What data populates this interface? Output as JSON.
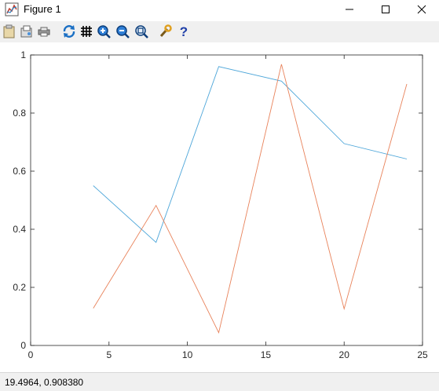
{
  "window": {
    "title": "Figure 1"
  },
  "toolbar": {
    "buttons": [
      {
        "name": "copy-icon"
      },
      {
        "name": "export-icon"
      },
      {
        "name": "print-icon"
      },
      {
        "name": "rotate-icon"
      },
      {
        "name": "grid-icon"
      },
      {
        "name": "zoom-in-icon"
      },
      {
        "name": "zoom-out-icon"
      },
      {
        "name": "autoscale-icon"
      },
      {
        "name": "settings-icon"
      },
      {
        "name": "help-icon"
      }
    ]
  },
  "status": {
    "coordinates": "19.4964,  0.908380"
  },
  "colors": {
    "series1": "#4da6d9",
    "series2": "#e8825a"
  },
  "chart_data": {
    "type": "line",
    "xlim": [
      0,
      25
    ],
    "ylim": [
      0,
      1
    ],
    "xticks": [
      0,
      5,
      10,
      15,
      20,
      25
    ],
    "yticks": [
      0,
      0.2,
      0.4,
      0.6,
      0.8,
      1
    ],
    "xtick_labels": [
      "0",
      "5",
      "10",
      "15",
      "20",
      "25"
    ],
    "ytick_labels": [
      "0",
      "0.2",
      "0.4",
      "0.6",
      "0.8",
      "1"
    ],
    "series": [
      {
        "x": [
          4,
          8,
          12,
          16,
          20,
          24
        ],
        "y": [
          0.55,
          0.355,
          0.96,
          0.91,
          0.695,
          0.642
        ],
        "color": "#4da6d9"
      },
      {
        "x": [
          4,
          8,
          12,
          16,
          20,
          24
        ],
        "y": [
          0.128,
          0.482,
          0.044,
          0.968,
          0.126,
          0.9
        ],
        "color": "#e8825a"
      }
    ],
    "grid": false
  }
}
